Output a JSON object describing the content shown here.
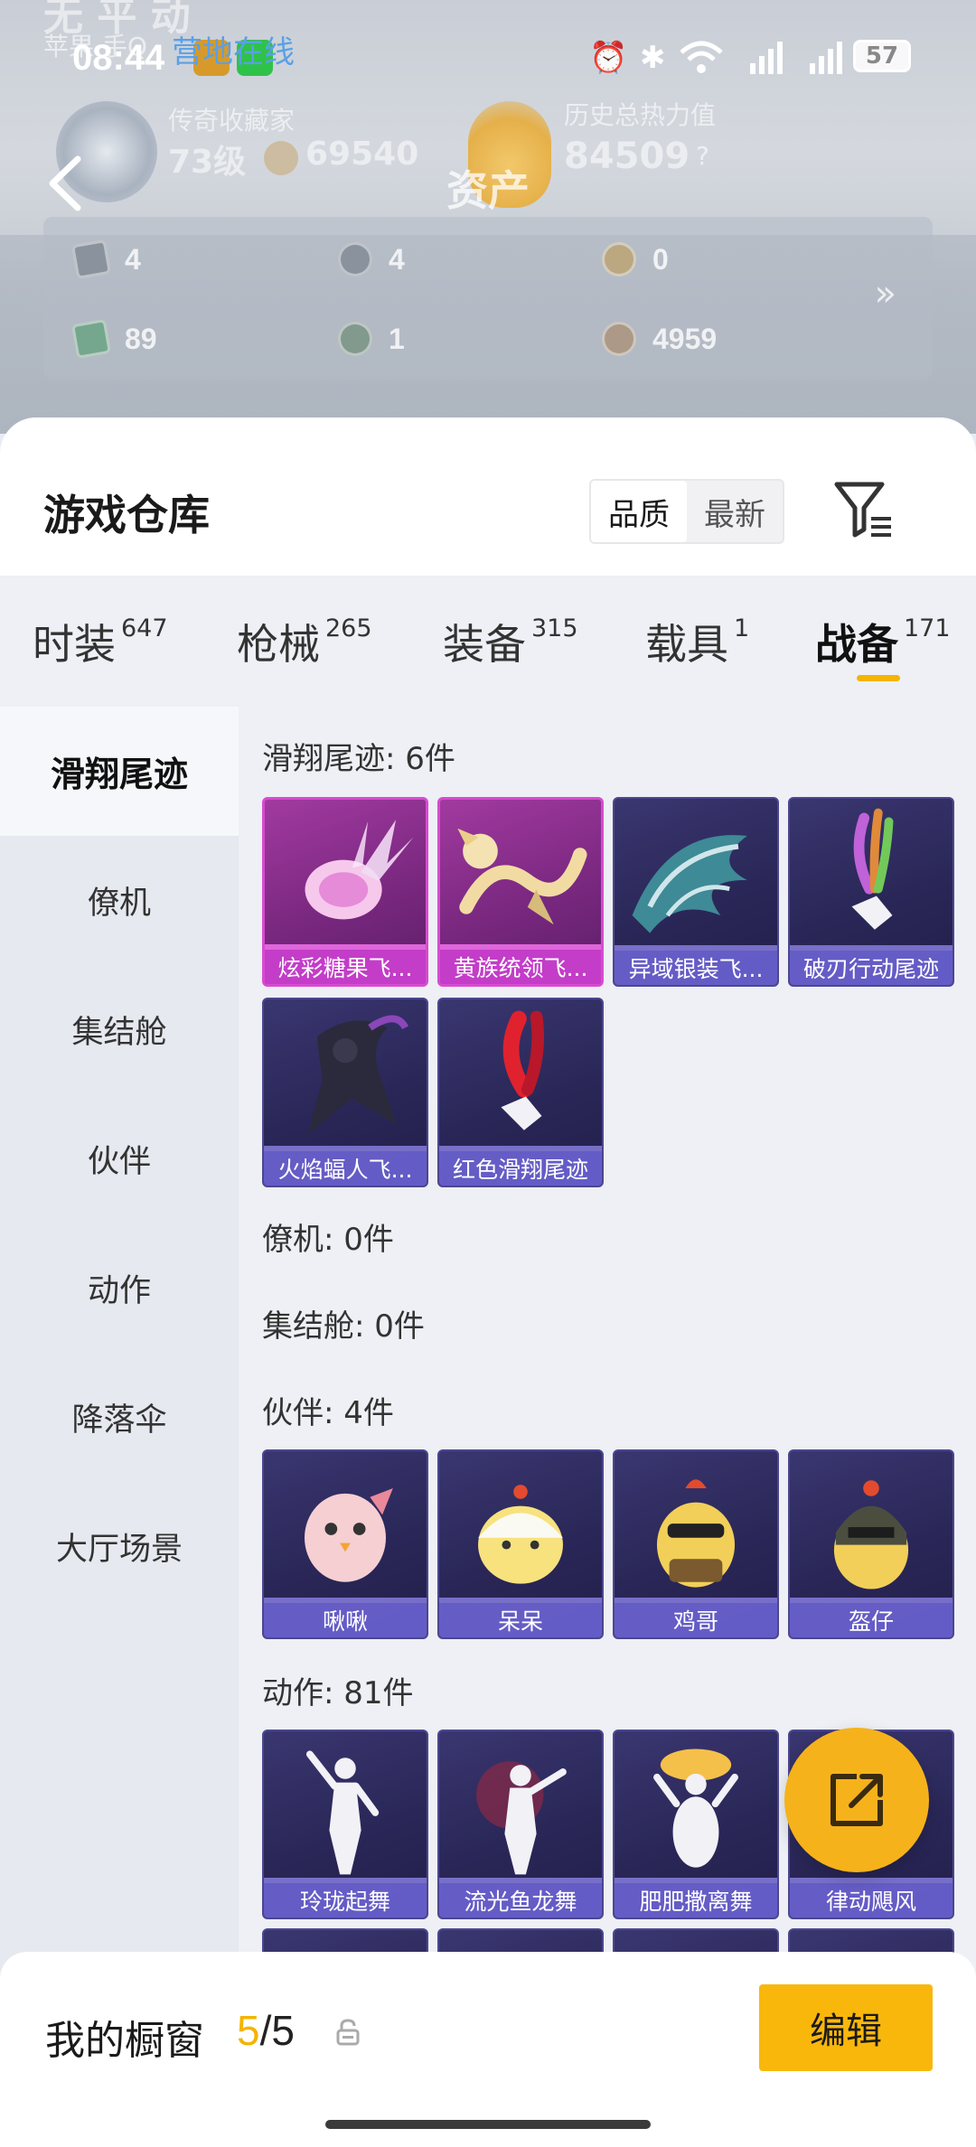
{
  "header": {
    "ghost_title": "无 平 动",
    "ghost_user": "苹果 手Q",
    "online_status": "营地在线",
    "page_title": "资产",
    "collector_label": "传奇收藏家",
    "level": "73级",
    "score": "69540",
    "heat_label": "历史总热力值",
    "heat_value": "84509",
    "heat_help": "?",
    "assets": [
      "4",
      "4",
      "0",
      "89",
      "1",
      "4959"
    ],
    "more_glyph": "»"
  },
  "status_bar": {
    "time": "08:44",
    "battery": "57"
  },
  "warehouse": {
    "title": "游戏仓库",
    "sort_quality": "品质",
    "sort_newest": "最新"
  },
  "tabs": [
    {
      "label": "时装",
      "count": "647"
    },
    {
      "label": "枪械",
      "count": "265"
    },
    {
      "label": "装备",
      "count": "315"
    },
    {
      "label": "载具",
      "count": "1"
    },
    {
      "label": "战备",
      "count": "171"
    }
  ],
  "sidebar": {
    "items": [
      {
        "label": "滑翔尾迹"
      },
      {
        "label": "僚机"
      },
      {
        "label": "集结舱"
      },
      {
        "label": "伙伴"
      },
      {
        "label": "动作"
      },
      {
        "label": "降落伞"
      },
      {
        "label": "大厅场景"
      }
    ]
  },
  "sections": {
    "trail": {
      "header": "滑翔尾迹: 6件",
      "items": [
        {
          "label": "炫彩糖果飞..."
        },
        {
          "label": "黄族统领飞..."
        },
        {
          "label": "异域银装飞..."
        },
        {
          "label": "破刃行动尾迹"
        },
        {
          "label": "火焰蝠人飞..."
        },
        {
          "label": "红色滑翔尾迹"
        }
      ]
    },
    "wingman": {
      "header": "僚机: 0件"
    },
    "pod": {
      "header": "集结舱: 0件"
    },
    "partner": {
      "header": "伙伴: 4件",
      "items": [
        {
          "label": "啾啾"
        },
        {
          "label": "呆呆"
        },
        {
          "label": "鸡哥"
        },
        {
          "label": "盔仔"
        }
      ]
    },
    "emote": {
      "header": "动作: 81件",
      "items": [
        {
          "label": "玲珑起舞"
        },
        {
          "label": "流光鱼龙舞"
        },
        {
          "label": "肥肥撒离舞"
        },
        {
          "label": "律动飓风"
        }
      ]
    }
  },
  "showcase": {
    "label": "我的橱窗",
    "current": "5",
    "separator": "/",
    "max": "5",
    "edit_label": "编辑"
  }
}
